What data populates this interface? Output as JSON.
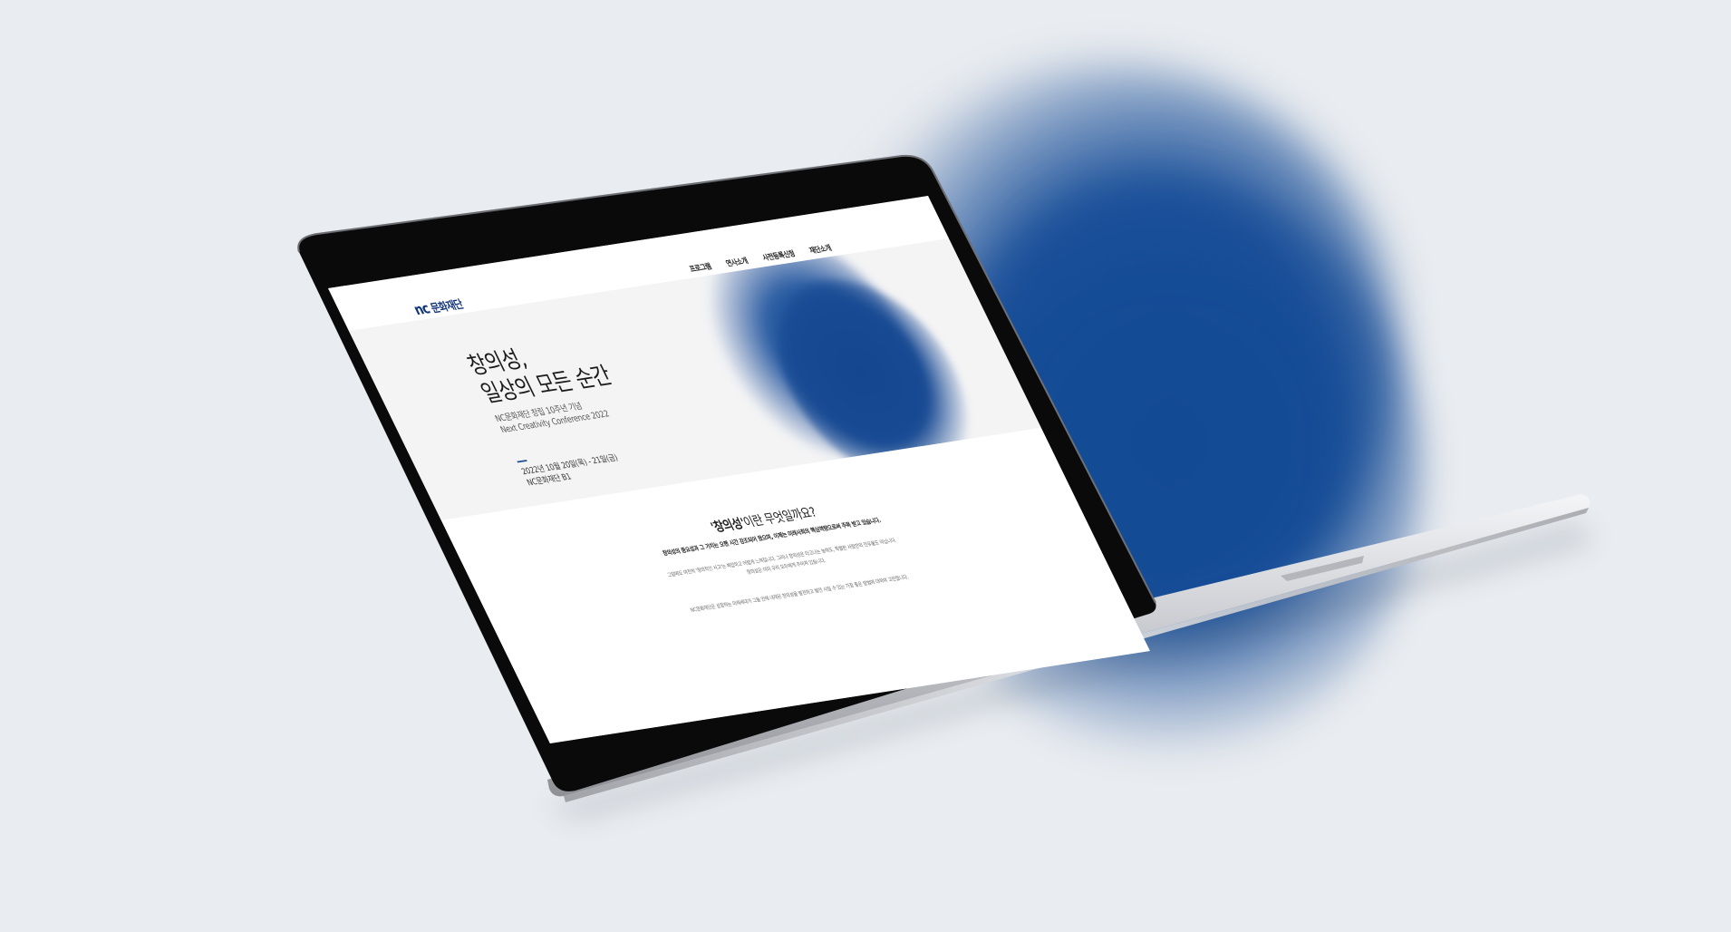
{
  "site": {
    "logo_mark": "nc",
    "logo_text": "문화재단",
    "nav": [
      {
        "label": "프로그램"
      },
      {
        "label": "연사소개"
      },
      {
        "label": "사전등록신청"
      },
      {
        "label": "재단소개"
      }
    ]
  },
  "hero": {
    "title_line1": "창의성,",
    "title_line2": "일상의 모든 순간",
    "sub_line1": "NC문화재단 창립 10주년 기념",
    "sub_line2": "Next Creativity Conference 2022",
    "date": "2022년 10월 20일(목) - 21일(금)",
    "venue": "NC문화재단 B1"
  },
  "about": {
    "title_strong": "'창의성'",
    "title_rest": "이란 무엇일까요?",
    "lead": "창의성의 중요성과 그 가치는 오랜 시간 강조되어 왔으며, 이제는 미래사회의 핵심역량으로써 주목 받고 있습니다.",
    "body_line1": "그럼에도 여전히 '창의적인 사고'는 복잡하고 어렵게 느껴집니다. 그러나 창의성은 타고나는 능력도, 특별한 사람만의 전유물도 아닙니다.",
    "body_line2": "창의성은 이미 우리 모두에게 주어져 있습니다.",
    "foot": "NC문화재단은 성장하는 미래세대가 그들 안에 내재된 창의성을 발견하고 발전 시킬 수 있는 가장 좋은 방법에 대하여 고민합니다."
  },
  "colors": {
    "background": "#e9ecf0",
    "brand_blue": "#174f98",
    "logo_navy": "#13367a"
  }
}
